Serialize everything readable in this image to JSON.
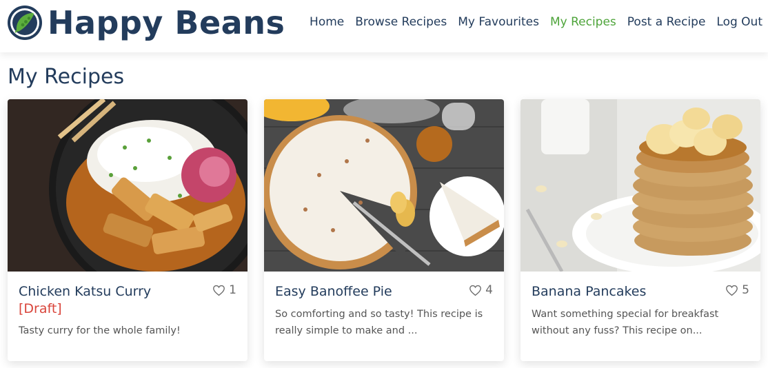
{
  "brand": {
    "name": "Happy Beans"
  },
  "nav": {
    "items": [
      {
        "label": "Home",
        "active": false
      },
      {
        "label": "Browse Recipes",
        "active": false
      },
      {
        "label": "My Favourites",
        "active": false
      },
      {
        "label": "My Recipes",
        "active": true
      },
      {
        "label": "Post a Recipe",
        "active": false
      },
      {
        "label": "Log Out",
        "active": false
      }
    ]
  },
  "page": {
    "title": "My Recipes"
  },
  "recipes": [
    {
      "title": "Chicken Katsu Curry",
      "status": "[Draft]",
      "likes": "1",
      "description": "Tasty curry for the whole family!"
    },
    {
      "title": "Easy Banoffee Pie",
      "status": "",
      "likes": "4",
      "description": "So comforting and so tasty! This recipe is really simple to make and ..."
    },
    {
      "title": "Banana Pancakes",
      "status": "",
      "likes": "5",
      "description": "Want something special for breakfast without any fuss? This recipe on..."
    }
  ],
  "colors": {
    "primary": "#233c5c",
    "accent": "#4ea43a",
    "draft": "#d9443a",
    "muted": "#555555"
  },
  "icons": {
    "logo": "bean-pod-logo-icon",
    "like": "heart-outline-icon"
  }
}
